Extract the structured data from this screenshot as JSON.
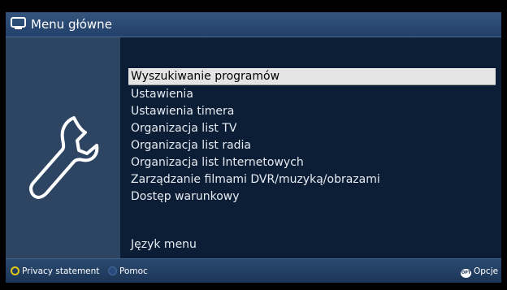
{
  "header": {
    "title": "Menu główne",
    "icon": "tv-icon"
  },
  "sidebar": {
    "icon": "wrench-icon"
  },
  "menu": {
    "items": [
      {
        "label": "Wyszukiwanie programów",
        "selected": true
      },
      {
        "label": "Ustawienia",
        "selected": false
      },
      {
        "label": "Ustawienia timera",
        "selected": false
      },
      {
        "label": "Organizacja list TV",
        "selected": false
      },
      {
        "label": "Organizacja list radia",
        "selected": false
      },
      {
        "label": "Organizacja list Internetowych",
        "selected": false
      },
      {
        "label": "Zarządzanie filmami DVR/muzyką/obrazami",
        "selected": false
      },
      {
        "label": "Dostęp warunkowy",
        "selected": false
      }
    ],
    "language_item": {
      "label": "Język menu",
      "selected": false
    }
  },
  "footer": {
    "yellow_label": "Privacy statement",
    "blue_label": "Pomoc",
    "opt_badge": "OPT",
    "opt_label": "Opcje"
  },
  "colors": {
    "selection": "#e4e4e4",
    "yellow_key": "#e5c516",
    "blue_key": "#294c7e"
  }
}
